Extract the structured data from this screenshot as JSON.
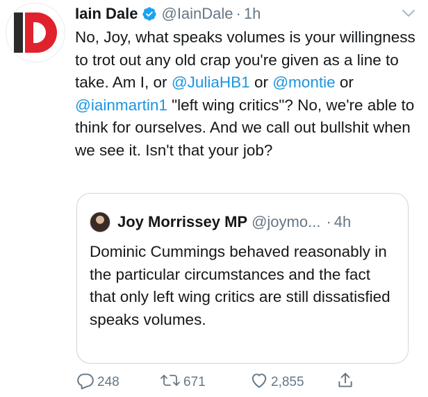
{
  "author": {
    "display_name": "Iain Dale",
    "handle": "@IainDale",
    "separator": "·",
    "time": "1h",
    "avatar_letters": "ID"
  },
  "tweet": {
    "segments": [
      {
        "text": "No, Joy, what speaks volumes is your willingness to trot out any old crap you're given as a line to take. Am I, or ",
        "type": "text"
      },
      {
        "text": "@JuliaHB1",
        "type": "mention"
      },
      {
        "text": " or ",
        "type": "text"
      },
      {
        "text": "@montie",
        "type": "mention"
      },
      {
        "text": " or ",
        "type": "text"
      },
      {
        "text": "@iainmartin1",
        "type": "mention"
      },
      {
        "text": " \"left wing critics\"? No, we're able to think for ourselves. And we call out bullshit when we see it. Isn't that your job?",
        "type": "text"
      }
    ]
  },
  "quoted": {
    "display_name": "Joy Morrissey MP",
    "handle": "@joymo...",
    "separator": "·",
    "time": "4h",
    "text": "Dominic Cummings behaved reasonably in the particular circumstances and the fact that only left wing critics are still dissatisfied speaks volumes."
  },
  "actions": {
    "replies": "248",
    "retweets": "671",
    "likes": "2,855"
  },
  "colors": {
    "link": "#1b95e0",
    "secondary": "#657786",
    "verified": "#1da1f2",
    "brand_red": "#e0222d"
  },
  "icons": [
    "verified-badge-icon",
    "chevron-down-icon",
    "reply-icon",
    "retweet-icon",
    "like-icon",
    "share-icon"
  ]
}
